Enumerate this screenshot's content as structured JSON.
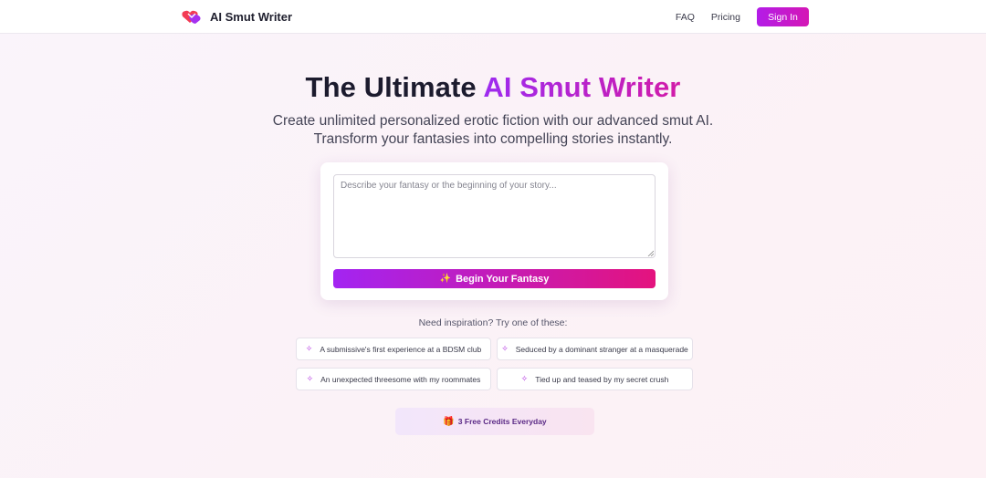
{
  "header": {
    "brand": "AI Smut Writer",
    "nav": {
      "faq": "FAQ",
      "pricing": "Pricing",
      "signin": "Sign In"
    }
  },
  "hero": {
    "title_plain": "The Ultimate ",
    "title_accent": "AI Smut Writer",
    "subtitle": "Create unlimited personalized erotic fiction with our advanced smut AI. Transform your fantasies into compelling stories instantly."
  },
  "composer": {
    "placeholder": "Describe your fantasy or the beginning of your story...",
    "submit_label": "Begin Your Fantasy"
  },
  "inspiration": {
    "label": "Need inspiration? Try one of these:",
    "prompts": [
      "A submissive's first experience at a BDSM club",
      "Seduced by a dominant stranger at a masquerade",
      "An unexpected threesome with my roommates",
      "Tied up and teased by my secret crush"
    ]
  },
  "credits": {
    "label": "3 Free Credits Everyday",
    "icon": "gift-icon"
  },
  "colors": {
    "accent_start": "#a324f2",
    "accent_end": "#e4137e"
  }
}
